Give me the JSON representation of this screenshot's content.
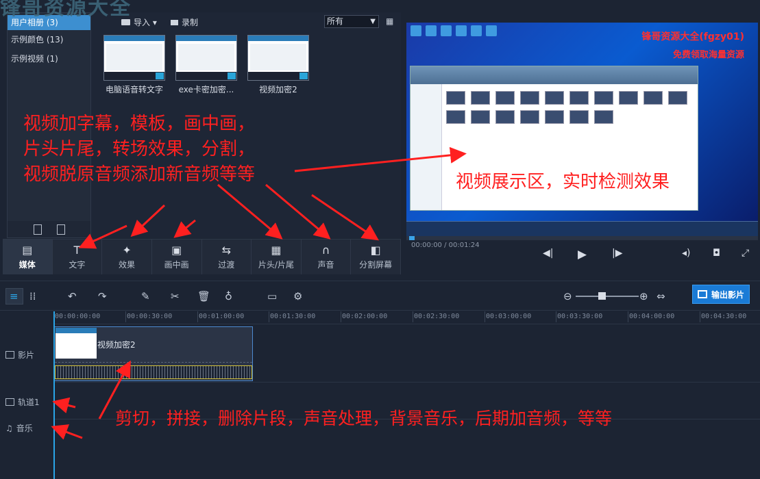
{
  "watermark": "锋哥资源大全",
  "albums": {
    "items": [
      "用户相册 (3)",
      "示例颜色 (13)",
      "示例视频 (1)"
    ]
  },
  "media_toolbar": {
    "import_label": "导入 ▾",
    "record_label": "录制",
    "filter_value": "所有"
  },
  "media_items": [
    {
      "label": "电脑语音转文字"
    },
    {
      "label": "exe卡密加密..."
    },
    {
      "label": "视频加密2"
    }
  ],
  "annotations": {
    "features_line1": "视频加字幕，模板，画中画，",
    "features_line2": "片头片尾，转场效果，分割，",
    "features_line3": "视频脱原音频添加新音频等等",
    "preview_caption": "视频展示区，实时检测效果",
    "timeline_caption": "剪切，拼接，删除片段，声音处理，背景音乐，后期加音频，等等"
  },
  "categories": [
    {
      "label": "媒体",
      "icon": "film-music-icon"
    },
    {
      "label": "文字",
      "icon": "text-icon"
    },
    {
      "label": "效果",
      "icon": "magic-wand-icon"
    },
    {
      "label": "画中画",
      "icon": "pip-icon"
    },
    {
      "label": "过渡",
      "icon": "transition-icon"
    },
    {
      "label": "片头/片尾",
      "icon": "clapper-icon"
    },
    {
      "label": "声音",
      "icon": "headphones-icon"
    },
    {
      "label": "分割屏幕",
      "icon": "split-screen-icon"
    }
  ],
  "preview": {
    "banner1": "锋哥资源大全(fgzy01)",
    "banner2": "免费领取海量资源",
    "timecode": "00:00:00 / 00:01:24"
  },
  "export_label": "输出影片",
  "ruler_ticks": [
    "00:00:00:00",
    "00:00:30:00",
    "00:01:00:00",
    "00:01:30:00",
    "00:02:00:00",
    "00:02:30:00",
    "00:03:00:00",
    "00:03:30:00",
    "00:04:00:00",
    "00:04:30:00"
  ],
  "tracks": {
    "video": "影片",
    "track1": "轨道1",
    "music": "音乐"
  },
  "clip": {
    "name": "视频加密2"
  },
  "colors": {
    "accent": "#1a7bd6",
    "annotation": "#ff2020",
    "background": "#1c2433"
  }
}
